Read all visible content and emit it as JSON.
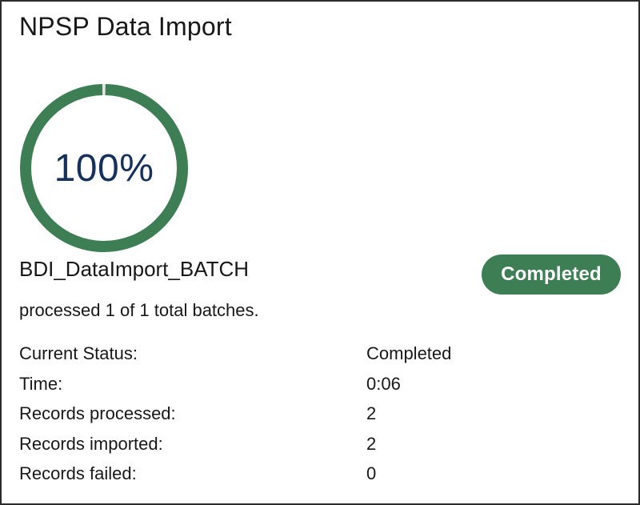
{
  "header": {
    "title": "NPSP Data Import"
  },
  "progress": {
    "percent_label": "100%",
    "fraction": 1.0,
    "color": "#3d7e54"
  },
  "job": {
    "name": "BDI_DataImport_BATCH",
    "status_badge": "Completed",
    "summary": "processed 1 of 1 total batches."
  },
  "details": [
    {
      "label": "Current Status:",
      "value": "Completed"
    },
    {
      "label": "Time:",
      "value": "0:06"
    },
    {
      "label": "Records processed:",
      "value": "2"
    },
    {
      "label": "Records imported:",
      "value": "2"
    },
    {
      "label": "Records failed:",
      "value": "0"
    }
  ],
  "colors": {
    "badge_bg": "#3d7e54",
    "progress_text": "#16325c"
  }
}
